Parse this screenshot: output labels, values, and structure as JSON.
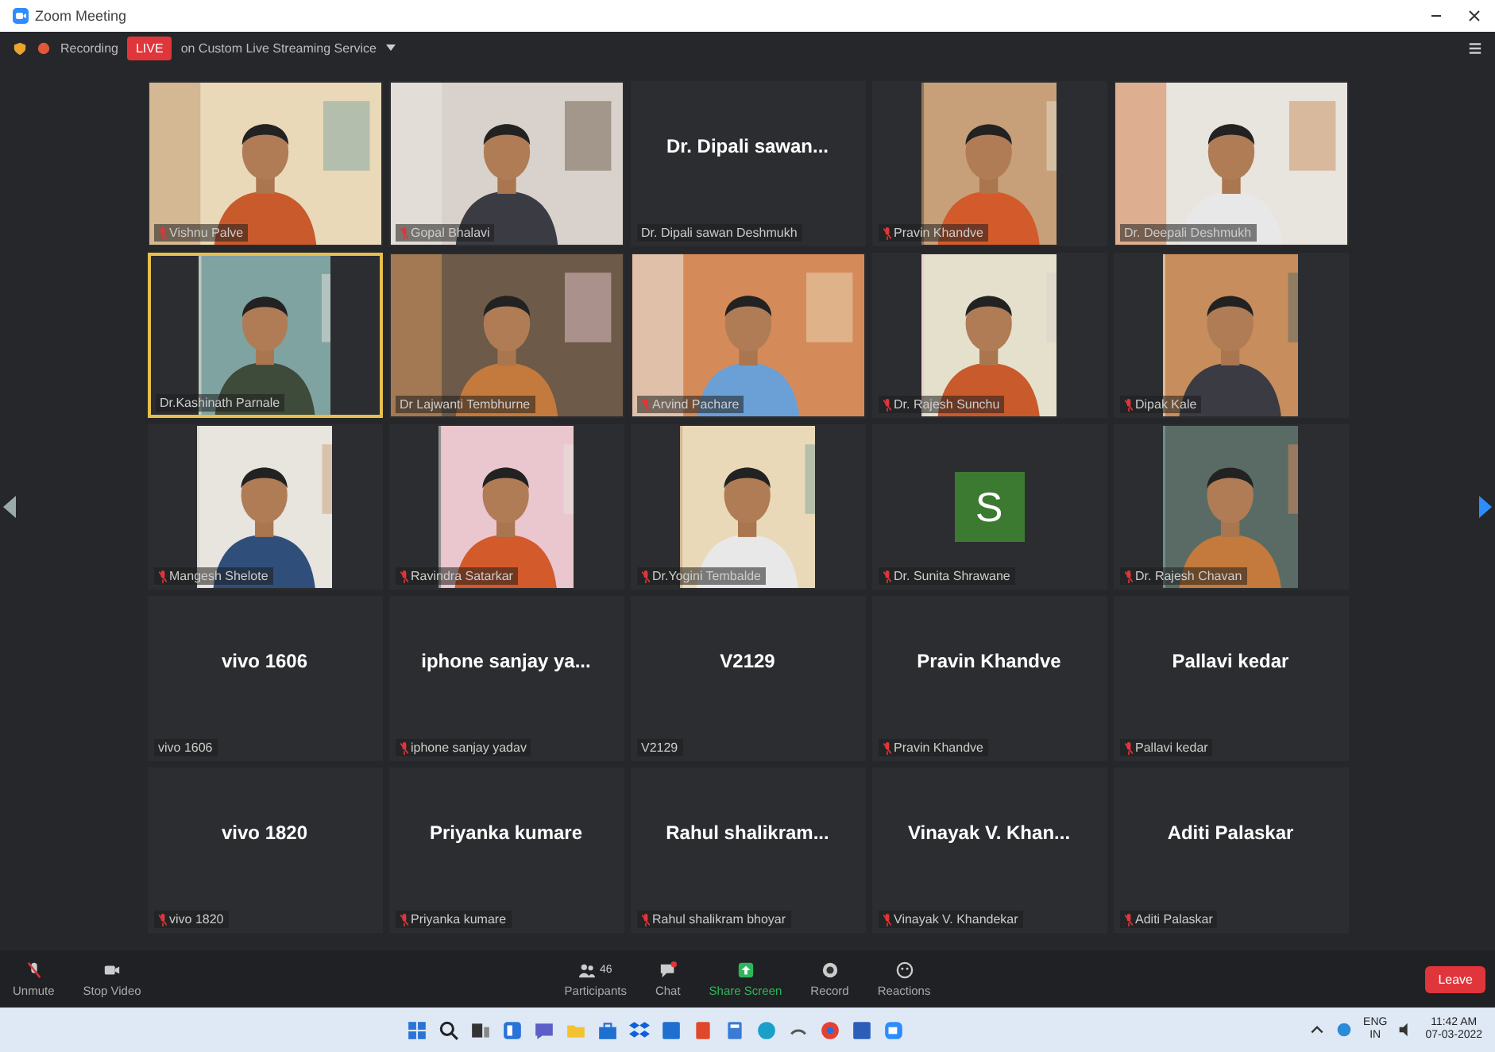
{
  "window": {
    "title": "Zoom Meeting"
  },
  "top_bar": {
    "recording": "Recording",
    "live_badge": "LIVE",
    "streaming": "on Custom Live Streaming Service"
  },
  "tiles": [
    {
      "kind": "video",
      "name": "Vishnu Palve",
      "muted": true,
      "speaking": false
    },
    {
      "kind": "video",
      "name": "Gopal Bhalavi",
      "muted": true,
      "speaking": false
    },
    {
      "kind": "name",
      "display": "Dr. Dipali sawan...",
      "name": "Dr. Dipali sawan Deshmukh",
      "muted": false,
      "speaking": false
    },
    {
      "kind": "portrait",
      "name": "Pravin Khandve",
      "muted": true,
      "speaking": false
    },
    {
      "kind": "video",
      "name": "Dr. Deepali Deshmukh",
      "muted": false,
      "speaking": false
    },
    {
      "kind": "portrait",
      "name": "Dr.Kashinath Parnale",
      "muted": false,
      "speaking": true
    },
    {
      "kind": "video",
      "name": "Dr Lajwanti Tembhurne",
      "muted": false,
      "speaking": false
    },
    {
      "kind": "video",
      "name": "Arvind Pachare",
      "muted": true,
      "speaking": false
    },
    {
      "kind": "portrait",
      "name": "Dr. Rajesh Sunchu",
      "muted": true,
      "speaking": false
    },
    {
      "kind": "portrait",
      "name": "Dipak Kale",
      "muted": true,
      "speaking": false
    },
    {
      "kind": "portrait",
      "name": "Mangesh Shelote",
      "muted": true,
      "speaking": false
    },
    {
      "kind": "portrait",
      "name": "Ravindra Satarkar",
      "muted": true,
      "speaking": false
    },
    {
      "kind": "portrait",
      "name": "Dr.Yogini Tembalde",
      "muted": true,
      "speaking": false
    },
    {
      "kind": "avatar",
      "letter": "S",
      "name": "Dr. Sunita Shrawane",
      "muted": true,
      "speaking": false
    },
    {
      "kind": "portrait",
      "name": "Dr. Rajesh Chavan",
      "muted": true,
      "speaking": false
    },
    {
      "kind": "name",
      "display": "vivo 1606",
      "name": "vivo 1606",
      "muted": false,
      "speaking": false
    },
    {
      "kind": "name",
      "display": "iphone sanjay ya...",
      "name": "iphone sanjay yadav",
      "muted": true,
      "speaking": false
    },
    {
      "kind": "name",
      "display": "V2129",
      "name": "V2129",
      "muted": false,
      "speaking": false
    },
    {
      "kind": "name",
      "display": "Pravin Khandve",
      "name": "Pravin Khandve",
      "muted": true,
      "speaking": false
    },
    {
      "kind": "name",
      "display": "Pallavi kedar",
      "name": "Pallavi kedar",
      "muted": true,
      "speaking": false
    },
    {
      "kind": "name",
      "display": "vivo 1820",
      "name": "vivo 1820",
      "muted": true,
      "speaking": false
    },
    {
      "kind": "name",
      "display": "Priyanka kumare",
      "name": "Priyanka kumare",
      "muted": true,
      "speaking": false
    },
    {
      "kind": "name",
      "display": "Rahul  shalikram...",
      "name": "Rahul shalikram bhoyar",
      "muted": true,
      "speaking": false
    },
    {
      "kind": "name",
      "display": "Vinayak V. Khan...",
      "name": "Vinayak V. Khandekar",
      "muted": true,
      "speaking": false
    },
    {
      "kind": "name",
      "display": "Aditi Palaskar",
      "name": "Aditi Palaskar",
      "muted": true,
      "speaking": false
    }
  ],
  "toolbar": [
    {
      "kind": "mic",
      "label": "Unmute"
    },
    {
      "kind": "camera",
      "label": "Stop Video"
    },
    {
      "kind": "participants",
      "label": "Participants",
      "count": "46"
    },
    {
      "kind": "chat",
      "label": "Chat"
    },
    {
      "kind": "share",
      "label": "Share Screen"
    },
    {
      "kind": "record",
      "label": "Record"
    },
    {
      "kind": "reactions",
      "label": "Reactions"
    }
  ],
  "leave_button": "Leave",
  "taskbar": {
    "language": "ENG",
    "region": "IN",
    "time": "11:42 AM",
    "date": "07-03-2022"
  }
}
